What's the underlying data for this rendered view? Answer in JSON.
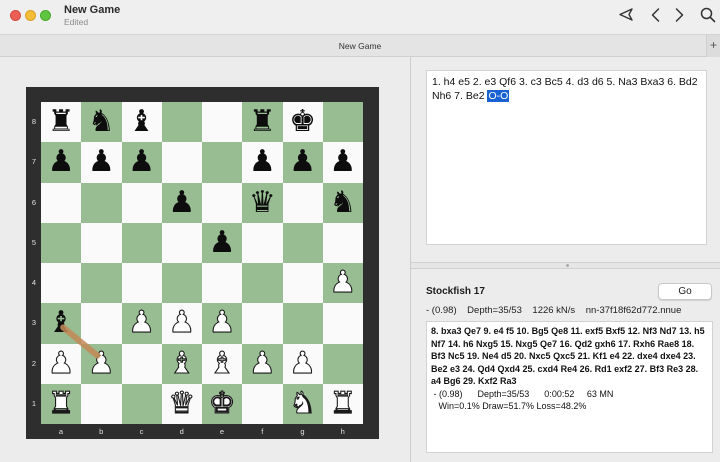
{
  "window": {
    "title": "New Game",
    "subtitle": "Edited"
  },
  "tab": {
    "label": "New Game",
    "add": "+"
  },
  "board": {
    "rows": [
      [
        "br",
        "bn",
        "bb",
        "",
        "",
        "br",
        "bk",
        ""
      ],
      [
        "bp",
        "bp",
        "bp",
        "",
        "",
        "bp",
        "bp",
        "bp"
      ],
      [
        "",
        "",
        "",
        "bp",
        "",
        "bq",
        "",
        "bn"
      ],
      [
        "",
        "",
        "",
        "",
        "bp",
        "",
        "",
        ""
      ],
      [
        "",
        "",
        "",
        "",
        "",
        "",
        "",
        "wp"
      ],
      [
        "bb",
        "",
        "wp",
        "wp",
        "wp",
        "",
        "",
        ""
      ],
      [
        "wp",
        "wp",
        "",
        "wb",
        "wb",
        "wp",
        "wp",
        ""
      ],
      [
        "wr",
        "",
        "",
        "wq",
        "wk",
        "",
        "wn",
        "wr"
      ]
    ],
    "ranks": [
      "8",
      "7",
      "6",
      "5",
      "4",
      "3",
      "2",
      "1"
    ],
    "files": [
      "a",
      "b",
      "c",
      "d",
      "e",
      "f",
      "g",
      "h"
    ],
    "arrow_color": "#c48a57"
  },
  "moves": {
    "text": "1. h4 e5 2. e3 Qf6 3. c3 Bc5 4. d3 d6 5. Na3 Bxa3 6. Bd2 Nh6 7. Be2 ",
    "current": "O-O"
  },
  "engine": {
    "name": "Stockfish 17",
    "go_label": "Go",
    "status": "- (0.98)    Depth=35/53    1226 kN/s    nn-37f18f62d772.nnue",
    "pv": "8. bxa3 Qe7 9. e4 f5 10. Bg5 Qe8 11. exf5 Bxf5 12. Nf3 Nd7 13. h5 Nf7 14. h6 Nxg5 15. Nxg5 Qe7 16. Qd2 gxh6 17. Rxh6 Rae8 18. Bf3 Nc5 19. Ne4 d5 20. Nxc5 Qxc5 21. Kf1 e4 22. dxe4 dxe4 23. Be2 e3 24. Qd4 Qxd4 25. cxd4 Re4 26. Rd1 exf2 27. Bf3 Re3 28. a4 Bg6 29. Kxf2 Ra3",
    "pv_line1": " - (0.98)      Depth=35/53      0:00:52     63 MN",
    "pv_line2": "   Win=0.1% Draw=51.7% Loss=48.2%"
  },
  "icons": {
    "send": "send-icon",
    "back": "chevron-left-icon",
    "forward": "chevron-right-icon",
    "search": "search-icon"
  }
}
